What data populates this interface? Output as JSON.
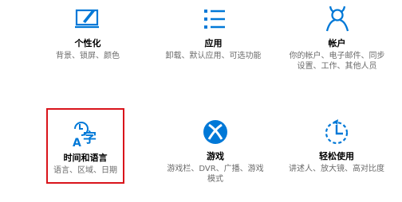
{
  "tiles": [
    {
      "title": "个性化",
      "desc": [
        "背景、锁屏、颜色"
      ]
    },
    {
      "title": "应用",
      "desc": [
        "卸载、默认应用、可选功能"
      ]
    },
    {
      "title": "帐户",
      "desc": [
        "你的帐户、电子邮件、同步",
        "设置、工作、其他人员"
      ]
    },
    {
      "title": "时间和语言",
      "desc": [
        "语言、区域、日期"
      ]
    },
    {
      "title": "游戏",
      "desc": [
        "游戏栏、DVR、广播、游戏",
        "模式"
      ]
    },
    {
      "title": "轻松使用",
      "desc": [
        "讲述人、放大镜、高对比度"
      ]
    }
  ],
  "colors": {
    "accent": "#0078d7",
    "highlight_border": "#d9141b",
    "desc_text": "#6b6b6b"
  },
  "icons": [
    "personalization-icon",
    "apps-icon",
    "accounts-icon",
    "time-language-icon",
    "gaming-xbox-icon",
    "ease-of-access-icon"
  ],
  "icon_glyph": {
    "time_language_char": "字",
    "time_language_letter": "A"
  }
}
